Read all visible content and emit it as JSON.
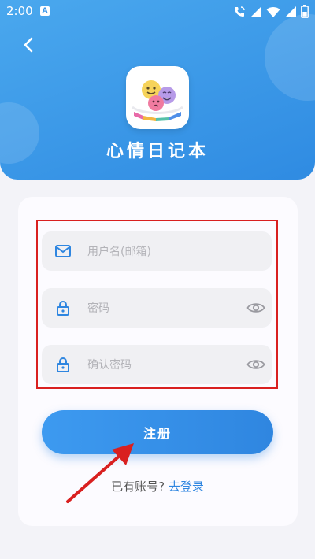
{
  "status_bar": {
    "time": "2:00",
    "notification_glyph": "A"
  },
  "app": {
    "title": "心情日记本"
  },
  "form": {
    "username_placeholder": "用户名(邮箱)",
    "password_placeholder": "密码",
    "confirm_password_placeholder": "确认密码"
  },
  "actions": {
    "register_label": "注册",
    "has_account_text": "已有账号?",
    "login_link": "去登录"
  },
  "colors": {
    "primary": "#2f86e0",
    "header_light": "#4aa8ee",
    "annotation_red": "#d92020",
    "placeholder": "#b3b3b8"
  },
  "icons": [
    "back-arrow-icon",
    "mail-icon",
    "lock-icon",
    "eye-icon",
    "wifi-icon",
    "signal-icon",
    "battery-icon",
    "call-icon"
  ]
}
